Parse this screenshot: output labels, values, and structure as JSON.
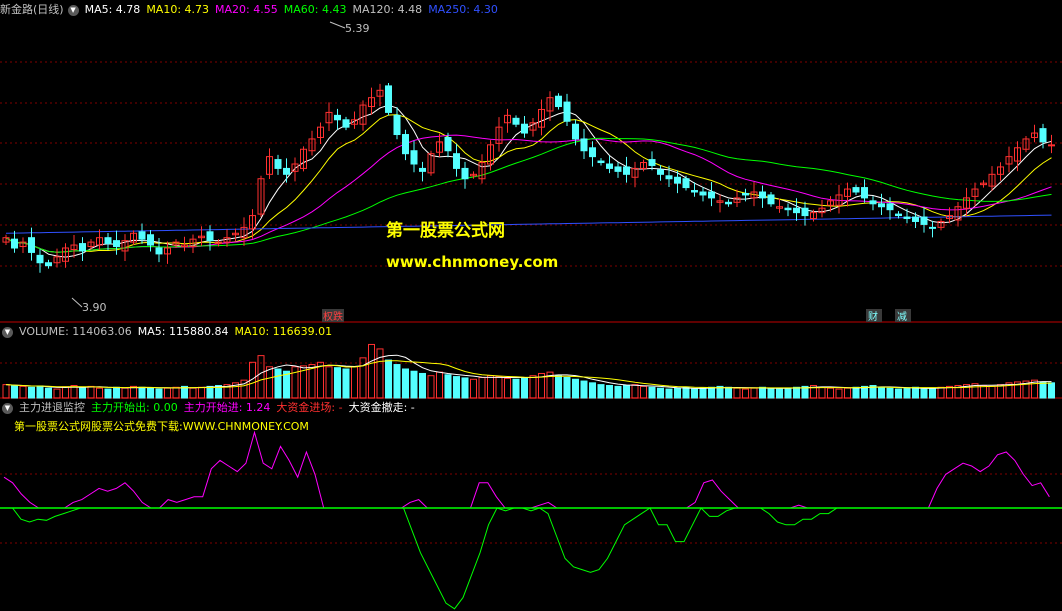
{
  "header": {
    "title": "新金路(日线)",
    "ma": [
      {
        "label": "MA5: 4.78",
        "color": "#ffffff"
      },
      {
        "label": "MA10: 4.73",
        "color": "#ffff00"
      },
      {
        "label": "MA20: 4.55",
        "color": "#ff00ff"
      },
      {
        "label": "MA60: 4.43",
        "color": "#00ff00"
      },
      {
        "label": "MA120: 4.48",
        "color": "#c0c0c0"
      },
      {
        "label": "MA250: 4.30",
        "color": "#3050ff"
      }
    ]
  },
  "volume_header": {
    "items": [
      {
        "label": "VOLUME: 114063.06",
        "color": "#c0c0c0"
      },
      {
        "label": "MA5: 115880.84",
        "color": "#ffffff"
      },
      {
        "label": "MA10: 116639.01",
        "color": "#ffff00"
      }
    ]
  },
  "indicator_header": {
    "title": "主力进退监控",
    "items": [
      {
        "label": "主力开始出: 0.00",
        "color": "#00ff00"
      },
      {
        "label": "主力开始进: 1.24",
        "color": "#ff00ff"
      },
      {
        "label": "大资金进场: -",
        "color": "#ff3030"
      },
      {
        "label": "大资金撤走: -",
        "color": "#ffffff"
      }
    ],
    "note": "第一股票公式网股票公式免费下载:WWW.CHNMONEY.COM"
  },
  "watermark": {
    "line1": "第一股票公式网",
    "line2": "www.chnmoney.com"
  },
  "annotations": {
    "high_label": "5.39",
    "low_label": "3.90",
    "marker_1": "权",
    "marker_1b": "跌",
    "marker_2": "财",
    "marker_3": "减"
  },
  "colors": {
    "up": "#ff3030",
    "down": "#54ffff",
    "grid": "#800000",
    "ma5": "#ffffff",
    "ma10": "#ffff00",
    "ma20": "#ff00ff",
    "ma60": "#00ff00",
    "ma250": "#3050ff"
  },
  "chart_data": [
    {
      "type": "candlestick",
      "title": "新金路(日线)",
      "ylim": [
        3.7,
        5.6
      ],
      "high": 5.39,
      "low": 3.9,
      "series": [
        {
          "name": "MA5",
          "last": 4.78
        },
        {
          "name": "MA10",
          "last": 4.73
        },
        {
          "name": "MA20",
          "last": 4.55
        },
        {
          "name": "MA60",
          "last": 4.43
        },
        {
          "name": "MA120",
          "last": 4.48
        },
        {
          "name": "MA250",
          "last": 4.3
        }
      ],
      "closes": [
        4.15,
        4.08,
        4.12,
        4.05,
        3.98,
        3.96,
        4.02,
        4.08,
        4.1,
        4.06,
        4.12,
        4.15,
        4.11,
        4.09,
        4.13,
        4.18,
        4.14,
        4.1,
        4.04,
        4.08,
        4.12,
        4.1,
        4.14,
        4.16,
        4.13,
        4.12,
        4.15,
        4.18,
        4.22,
        4.3,
        4.55,
        4.7,
        4.62,
        4.58,
        4.65,
        4.75,
        4.82,
        4.9,
        5.0,
        4.95,
        4.9,
        4.95,
        5.05,
        5.1,
        5.15,
        5.0,
        4.85,
        4.72,
        4.65,
        4.6,
        4.72,
        4.8,
        4.74,
        4.62,
        4.55,
        4.58,
        4.66,
        4.78,
        4.9,
        4.98,
        4.92,
        4.86,
        4.93,
        5.02,
        5.1,
        5.04,
        4.94,
        4.82,
        4.74,
        4.7,
        4.66,
        4.62,
        4.6,
        4.58,
        4.62,
        4.66,
        4.64,
        4.58,
        4.55,
        4.52,
        4.49,
        4.46,
        4.44,
        4.42,
        4.4,
        4.38,
        4.42,
        4.44,
        4.46,
        4.42,
        4.38,
        4.36,
        4.34,
        4.32,
        4.3,
        4.32,
        4.35,
        4.4,
        4.44,
        4.48,
        4.46,
        4.42,
        4.38,
        4.36,
        4.34,
        4.3,
        4.28,
        4.26,
        4.24,
        4.22,
        4.26,
        4.3,
        4.36,
        4.42,
        4.48,
        4.52,
        4.58,
        4.63,
        4.7,
        4.76,
        4.82,
        4.86,
        4.8,
        4.78
      ]
    },
    {
      "type": "bar",
      "title": "VOLUME",
      "series": [
        {
          "name": "VOLUME",
          "last": 114063.06
        },
        {
          "name": "MA5",
          "last": 115880.84
        },
        {
          "name": "MA10",
          "last": 116639.01
        }
      ],
      "values": [
        30,
        28,
        26,
        24,
        27,
        22,
        20,
        25,
        28,
        24,
        26,
        22,
        20,
        24,
        22,
        26,
        24,
        22,
        20,
        22,
        24,
        26,
        22,
        24,
        26,
        28,
        30,
        34,
        40,
        80,
        95,
        70,
        65,
        60,
        70,
        72,
        75,
        80,
        70,
        68,
        65,
        70,
        90,
        120,
        110,
        85,
        75,
        65,
        60,
        55,
        50,
        58,
        52,
        48,
        45,
        42,
        46,
        50,
        48,
        44,
        42,
        46,
        50,
        55,
        58,
        50,
        46,
        42,
        38,
        34,
        30,
        28,
        26,
        28,
        30,
        26,
        24,
        22,
        20,
        22,
        24,
        20,
        22,
        24,
        26,
        24,
        22,
        20,
        22,
        24,
        22,
        20,
        22,
        24,
        26,
        28,
        24,
        22,
        20,
        22,
        24,
        26,
        28,
        24,
        22,
        20,
        22,
        24,
        20,
        22,
        24,
        26,
        28,
        30,
        32,
        28,
        26,
        30,
        34,
        36,
        38,
        40,
        36,
        34
      ]
    },
    {
      "type": "line",
      "title": "主力进退监控",
      "series": [
        {
          "name": "主力开始出",
          "last": 0.0,
          "color": "#00ff00",
          "values": [
            0,
            0,
            -0.2,
            -0.25,
            -0.2,
            -0.22,
            -0.15,
            -0.1,
            -0.05,
            0,
            0,
            0,
            0,
            0,
            0,
            0,
            0,
            0,
            0,
            0,
            0,
            0,
            0,
            0,
            0,
            0,
            0,
            0,
            0,
            0,
            0,
            0,
            0,
            0,
            0,
            0,
            0,
            0,
            0,
            0,
            0,
            0,
            0,
            0,
            0,
            0,
            0,
            0,
            -0.4,
            -0.8,
            -1.1,
            -1.4,
            -1.7,
            -1.8,
            -1.6,
            -1.2,
            -0.8,
            -0.3,
            0,
            -0.05,
            0,
            0,
            -0.05,
            0,
            -0.1,
            -0.5,
            -0.9,
            -1.05,
            -1.1,
            -1.15,
            -1.1,
            -0.9,
            -0.6,
            -0.3,
            -0.2,
            -0.1,
            0,
            -0.3,
            -0.3,
            -0.6,
            -0.6,
            -0.3,
            0,
            -0.15,
            -0.15,
            -0.05,
            0,
            0,
            0,
            0,
            -0.1,
            -0.25,
            -0.3,
            -0.3,
            -0.2,
            -0.2,
            -0.1,
            -0.1,
            0,
            0,
            0,
            0,
            0,
            0,
            0,
            0,
            0,
            0,
            0,
            0,
            0,
            0,
            0,
            0,
            0,
            0,
            0,
            0,
            0,
            0,
            0,
            0,
            0,
            0
          ]
        },
        {
          "name": "主力开始进",
          "last": 1.24,
          "color": "#ff00ff",
          "values": [
            0.55,
            0.45,
            0.25,
            0.1,
            0,
            0,
            0,
            0,
            0.1,
            0.15,
            0.25,
            0.35,
            0.3,
            0.35,
            0.45,
            0.3,
            0.1,
            0,
            0,
            0.15,
            0.1,
            0.15,
            0.2,
            0.2,
            0.7,
            0.85,
            0.75,
            0.65,
            0.8,
            1.35,
            0.8,
            0.7,
            1.1,
            0.85,
            0.55,
            1.0,
            0.6,
            0,
            0,
            0,
            0,
            0,
            0,
            0,
            0,
            0,
            0,
            0.1,
            0.15,
            0,
            0,
            0,
            0,
            0,
            0,
            0.45,
            0.45,
            0.2,
            0,
            0,
            0,
            0,
            0.05,
            0.1,
            0,
            0,
            0,
            0,
            0,
            0,
            0,
            0,
            0,
            0,
            0,
            0,
            0,
            0,
            0,
            0,
            0.1,
            0.45,
            0.5,
            0.3,
            0.15,
            0,
            0,
            0,
            0,
            0,
            0,
            0,
            0.05,
            0,
            0,
            0,
            0,
            0,
            0,
            0,
            0,
            0,
            0,
            0,
            0,
            0,
            0,
            0,
            0.35,
            0.6,
            0.7,
            0.8,
            0.75,
            0.65,
            0.75,
            0.95,
            1.0,
            0.85,
            0.6,
            0.4,
            0.45,
            0.2
          ]
        }
      ]
    }
  ]
}
